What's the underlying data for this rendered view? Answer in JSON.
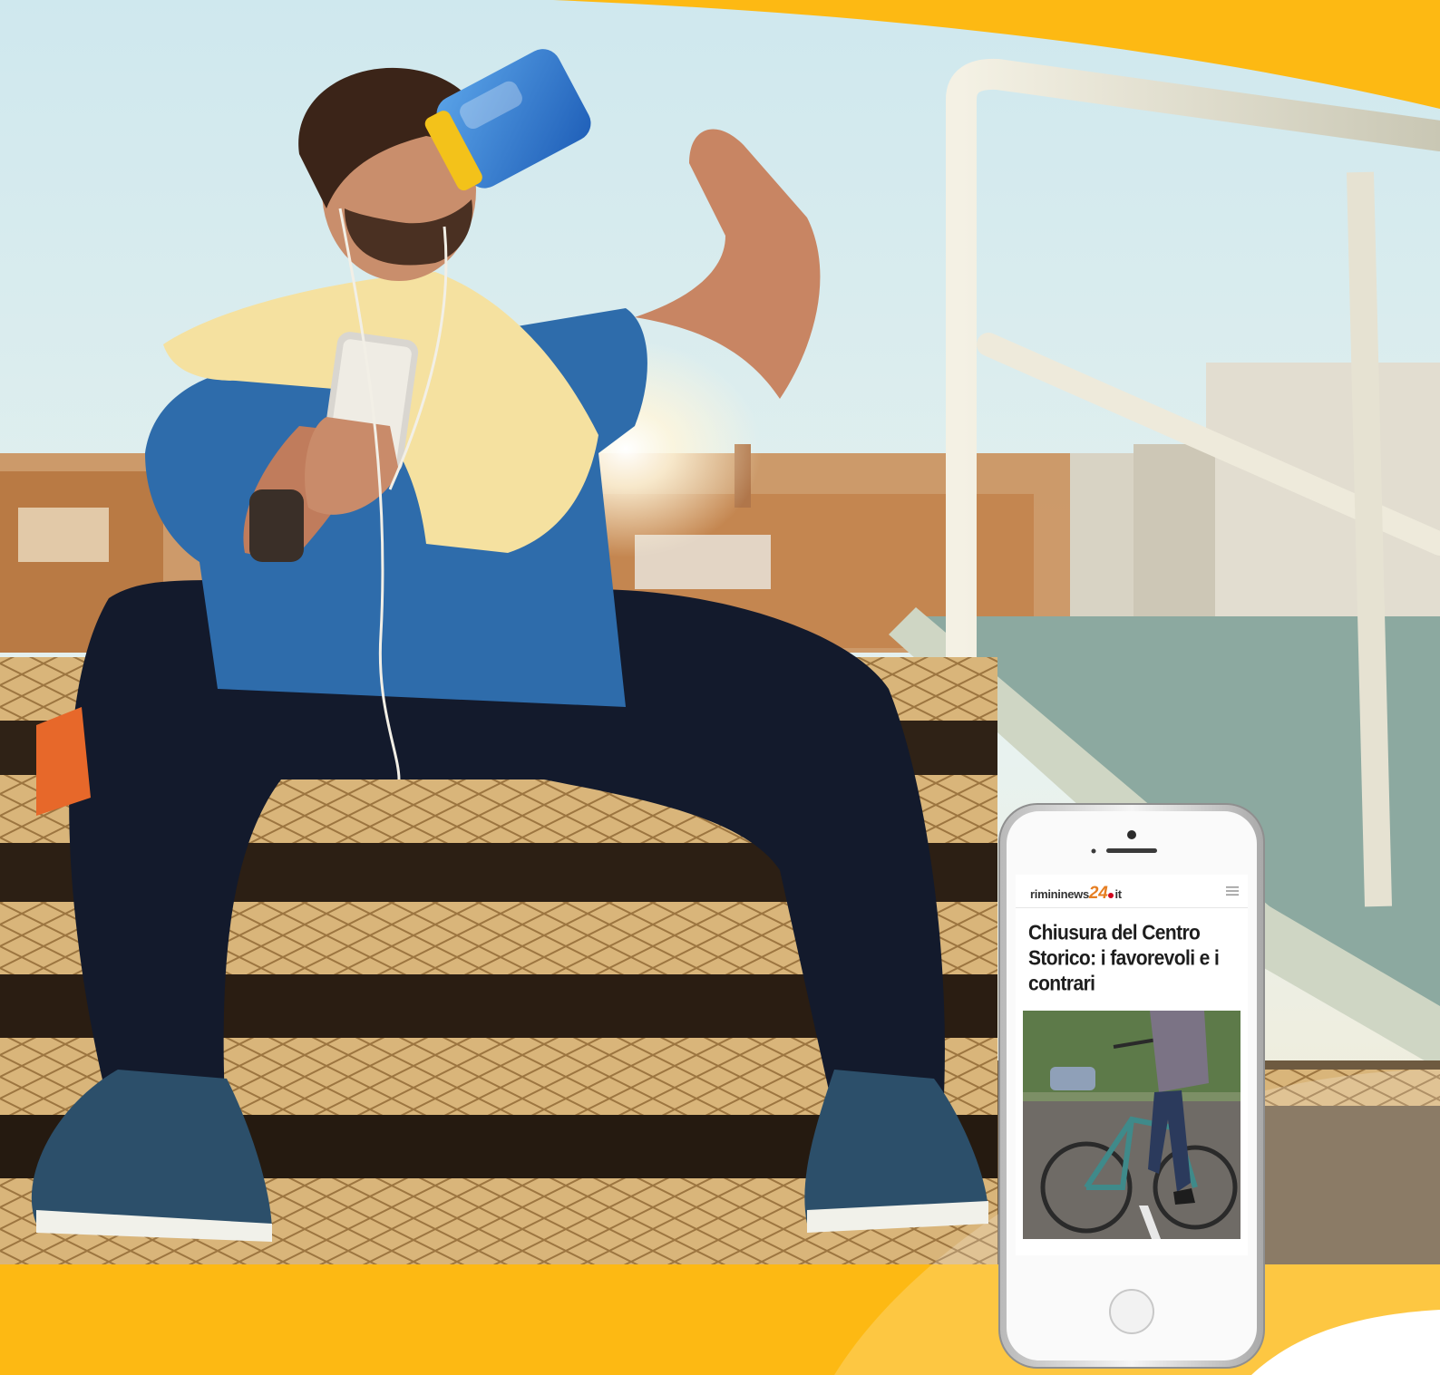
{
  "article": {
    "site_name": "rimininews",
    "site_number": "24",
    "site_tld": "it",
    "headline": "Chiusura del Centro Storico: i favorevoli e i contrari"
  },
  "colors": {
    "brand_yellow": "#fdb913",
    "logo_orange": "#e67e22",
    "logo_red": "#d0021b",
    "headline_text": "#1d1d1d"
  },
  "icons": {
    "menu": "hamburger-menu-icon"
  }
}
